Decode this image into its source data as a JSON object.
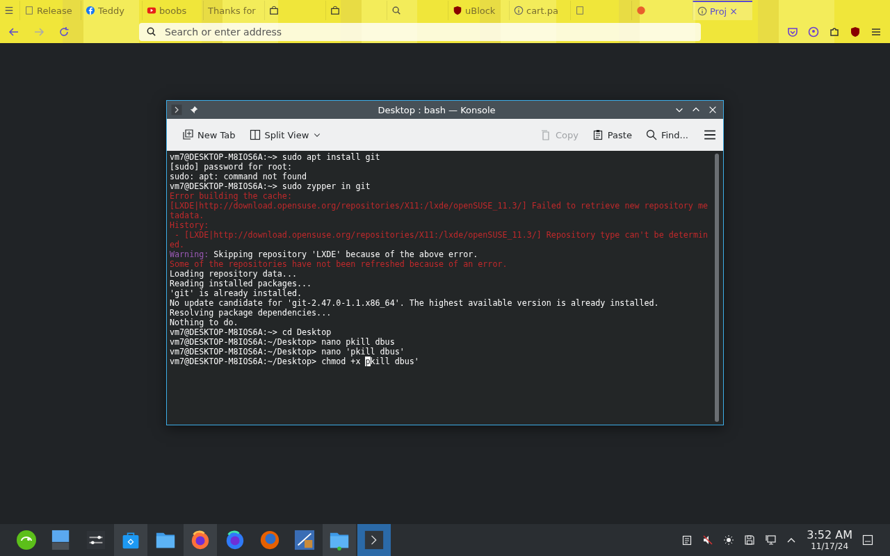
{
  "browser": {
    "tabs": [
      {
        "label": "Release",
        "selected": false,
        "kind": "page"
      },
      {
        "label": "Teddy",
        "selected": false,
        "kind": "f"
      },
      {
        "label": "boobs",
        "selected": false,
        "kind": "play"
      },
      {
        "label": "Thanks for",
        "selected": false,
        "kind": "none"
      },
      {
        "selected": false,
        "kind": "bag"
      },
      {
        "selected": false,
        "kind": "bag"
      },
      {
        "selected": false,
        "kind": "search"
      },
      {
        "label": "uBlock",
        "selected": false,
        "kind": "shield"
      },
      {
        "label": "cart.pa",
        "selected": false,
        "kind": "info"
      },
      {
        "selected": false,
        "kind": "page"
      },
      {
        "selected": false,
        "kind": "dot"
      },
      {
        "label": "Proj",
        "selected": true,
        "kind": "info"
      }
    ],
    "close_tab": "×",
    "address": {
      "placeholder": "Search or enter address"
    }
  },
  "konsole": {
    "title": "Desktop : bash — Konsole",
    "toolbar": [
      {
        "label": "New Tab",
        "kind": "newtab",
        "disabled": false
      },
      {
        "label": "Split View",
        "kind": "split",
        "disabled": false
      },
      {
        "label": "Copy",
        "kind": "copy",
        "disabled": true
      },
      {
        "label": "Paste",
        "kind": "paste",
        "disabled": false
      },
      {
        "label": "Find...",
        "kind": "find",
        "disabled": false
      }
    ],
    "lines": [
      {
        "kind": "out",
        "text": "vm7@DESKTOP-M8IOS6A:~> sudo apt install git"
      },
      {
        "kind": "out",
        "text": "[sudo] password for root:"
      },
      {
        "kind": "out",
        "text": "sudo: apt: command not found"
      },
      {
        "kind": "out",
        "text": "vm7@DESKTOP-M8IOS6A:~> sudo zypper in git"
      },
      {
        "kind": "err",
        "text": "Error building the cache:"
      },
      {
        "kind": "err",
        "text": "[LXDE|http://download.opensuse.org/repositories/X11:/lxde/openSUSE_11.3/] Failed to retrieve new repository me"
      },
      {
        "kind": "err",
        "text": "tadata."
      },
      {
        "kind": "err",
        "text": "History:"
      },
      {
        "kind": "err",
        "text": " - [LXDE|http://download.opensuse.org/repositories/X11:/lxde/openSUSE_11.3/] Repository type can't be determin"
      },
      {
        "kind": "err",
        "text": "ed."
      },
      {
        "kind": "warn",
        "label": "Warning:",
        "text": " Skipping repository 'LXDE' because of the above error."
      },
      {
        "kind": "err",
        "text": "Some of the repositories have not been refreshed because of an error."
      },
      {
        "kind": "out",
        "text": "Loading repository data..."
      },
      {
        "kind": "out",
        "text": "Reading installed packages..."
      },
      {
        "kind": "out",
        "text": "'git' is already installed."
      },
      {
        "kind": "out",
        "text": "No update candidate for 'git-2.47.0-1.1.x86_64'. The highest available version is already installed."
      },
      {
        "kind": "out",
        "text": "Resolving package dependencies..."
      },
      {
        "kind": "out",
        "text": "Nothing to do."
      },
      {
        "kind": "out",
        "text": "vm7@DESKTOP-M8IOS6A:~> cd Desktop"
      },
      {
        "kind": "out",
        "text": "vm7@DESKTOP-M8IOS6A:~/Desktop> nano pkill dbus"
      },
      {
        "kind": "out",
        "text": "vm7@DESKTOP-M8IOS6A:~/Desktop> nano 'pkill dbus'"
      },
      {
        "kind": "cursor",
        "text": "vm7@DESKTOP-M8IOS6A:~/Desktop> chmod +x ",
        "cursor": "p",
        "rest": "kill dbus'"
      }
    ]
  },
  "taskbar": {
    "apps": [
      {
        "kind": "suse",
        "active": false
      },
      {
        "kind": "desktop",
        "active": false
      },
      {
        "kind": "sliders",
        "active": false
      },
      {
        "kind": "store",
        "active": true
      },
      {
        "kind": "folder",
        "active": false
      },
      {
        "kind": "firefox",
        "active": true
      },
      {
        "kind": "firefox-dev",
        "active": false
      },
      {
        "kind": "firefox-old",
        "active": false
      },
      {
        "kind": "editor",
        "active": false
      },
      {
        "kind": "folder-add",
        "active": true
      },
      {
        "kind": "terminal",
        "active": true,
        "selected": true
      }
    ],
    "time": "3:52 AM",
    "date": "11/17/24"
  }
}
